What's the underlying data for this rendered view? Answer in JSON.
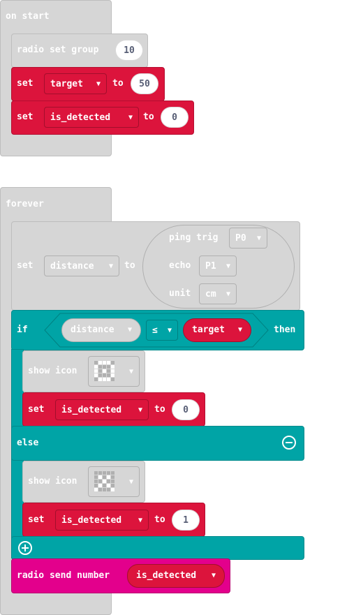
{
  "on_start": {
    "hat_label": "on start",
    "radio_set_group": {
      "label": "radio set group",
      "value": "10"
    },
    "set_target": {
      "set": "set",
      "variable": "target",
      "to": "to",
      "value": "50"
    },
    "set_is_detected": {
      "set": "set",
      "variable": "is_detected",
      "to": "to",
      "value": "0"
    }
  },
  "forever": {
    "hat_label": "forever",
    "set_distance": {
      "set": "set",
      "variable": "distance",
      "to": "to",
      "ping_trig": "ping trig",
      "trig_pin": "P0",
      "echo": "echo",
      "echo_pin": "P1",
      "unit": "unit",
      "unit_value": "cm"
    },
    "if_block": {
      "if": "if",
      "left": "distance",
      "operator": "≤",
      "right": "target",
      "then": "then",
      "show_icon_1": "show icon",
      "set_1": {
        "set": "set",
        "variable": "is_detected",
        "to": "to",
        "value": "0"
      },
      "else": "else",
      "show_icon_2": "show icon",
      "set_2": {
        "set": "set",
        "variable": "is_detected",
        "to": "to",
        "value": "1"
      }
    },
    "radio_send": {
      "label": "radio send number",
      "variable": "is_detected"
    }
  },
  "colors": {
    "gray_block": "#d6d6d6",
    "variables_red": "#dc143c",
    "logic_teal": "#00a4a6",
    "radio_pink": "#e3008c"
  },
  "icons": {
    "dropdown": "caret-down-icon",
    "remove": "minus-circle-icon",
    "add": "plus-circle-icon"
  }
}
